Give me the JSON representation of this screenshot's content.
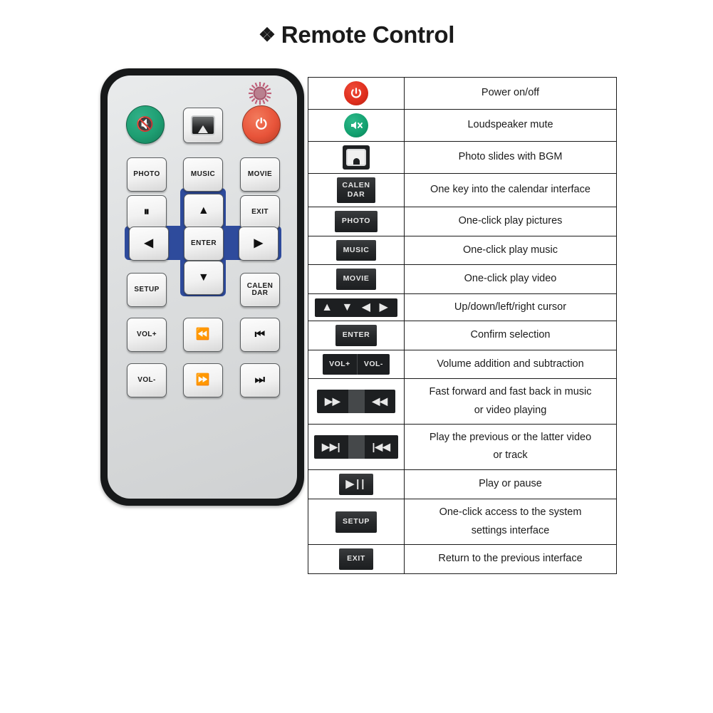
{
  "page": {
    "title": "Remote Control",
    "title_bullet": "diamond-bullet-icon"
  },
  "colors": {
    "remote_shell": "#17191a",
    "remote_face": "#dcdedf",
    "dpad_blue": "#2e4b9c",
    "power_red": "#e8543a",
    "mute_green": "#1e9e72",
    "table_border": "#1a1a1a",
    "keycap_dark": "#26282a"
  },
  "remote": {
    "name": "remote-control-device",
    "ir_led": "ir-led-icon",
    "buttons": [
      {
        "key": "mute",
        "label": "",
        "icon": "speaker-mute-icon",
        "shape": "round",
        "color": "green"
      },
      {
        "key": "photo-slide",
        "label": "",
        "icon": "photo-slideshow-icon",
        "shape": "square",
        "color": "white"
      },
      {
        "key": "power",
        "label": "",
        "icon": "power-icon",
        "shape": "round",
        "color": "red"
      },
      {
        "key": "photo",
        "label": "PHOTO",
        "icon": "",
        "shape": "square",
        "color": "white"
      },
      {
        "key": "music",
        "label": "MUSIC",
        "icon": "",
        "shape": "square",
        "color": "white"
      },
      {
        "key": "movie",
        "label": "MOVIE",
        "icon": "",
        "shape": "square",
        "color": "white"
      },
      {
        "key": "play-pause",
        "label": "",
        "icon": "play-pause-icon",
        "shape": "square",
        "color": "white"
      },
      {
        "key": "up",
        "label": "",
        "icon": "arrow-up-icon",
        "shape": "square",
        "color": "white"
      },
      {
        "key": "exit",
        "label": "EXIT",
        "icon": "",
        "shape": "square",
        "color": "white"
      },
      {
        "key": "left",
        "label": "",
        "icon": "arrow-left-icon",
        "shape": "square",
        "color": "white"
      },
      {
        "key": "enter",
        "label": "ENTER",
        "icon": "",
        "shape": "square",
        "color": "white"
      },
      {
        "key": "right",
        "label": "",
        "icon": "arrow-right-icon",
        "shape": "square",
        "color": "white"
      },
      {
        "key": "setup",
        "label": "SETUP",
        "icon": "",
        "shape": "square",
        "color": "white"
      },
      {
        "key": "down",
        "label": "",
        "icon": "arrow-down-icon",
        "shape": "square",
        "color": "white"
      },
      {
        "key": "calendar",
        "label": "CALEN DAR",
        "label_line1": "CALEN",
        "label_line2": "DAR",
        "icon": "",
        "shape": "square",
        "color": "white"
      },
      {
        "key": "vol-up",
        "label": "VOL+",
        "icon": "",
        "shape": "square",
        "color": "white"
      },
      {
        "key": "rewind",
        "label": "",
        "icon": "rewind-icon",
        "shape": "square",
        "color": "white"
      },
      {
        "key": "prev-track",
        "label": "",
        "icon": "previous-track-icon",
        "shape": "square",
        "color": "white"
      },
      {
        "key": "vol-down",
        "label": "VOL-",
        "icon": "",
        "shape": "square",
        "color": "white"
      },
      {
        "key": "fast-forward",
        "label": "",
        "icon": "fast-forward-icon",
        "shape": "square",
        "color": "white"
      },
      {
        "key": "next-track",
        "label": "",
        "icon": "next-track-icon",
        "shape": "square",
        "color": "white"
      }
    ]
  },
  "table": {
    "name": "remote-key-function-table",
    "rows": [
      {
        "icon_kind": "circle-red",
        "icon_name": "power-icon",
        "key_label": "",
        "description": "Power on/off"
      },
      {
        "icon_kind": "circle-green",
        "icon_name": "speaker-mute-icon",
        "key_label": "",
        "description": "Loudspeaker mute"
      },
      {
        "icon_kind": "monitor",
        "icon_name": "photo-slideshow-icon",
        "key_label": "",
        "description": "Photo slides with BGM"
      },
      {
        "icon_kind": "keycap2",
        "icon_name": "calendar-key",
        "key_label_line1": "CALEN",
        "key_label_line2": "DAR",
        "description": "One key into the calendar interface"
      },
      {
        "icon_kind": "keycap",
        "icon_name": "photo-key",
        "key_label": "PHOTO",
        "description": "One-click play pictures"
      },
      {
        "icon_kind": "keycap",
        "icon_name": "music-key",
        "key_label": "MUSIC",
        "description": "One-click play music"
      },
      {
        "icon_kind": "keycap",
        "icon_name": "movie-key",
        "key_label": "MOVIE",
        "description": "One-click play video"
      },
      {
        "icon_kind": "arrowbar",
        "icon_name": "cursor-arrows-icon",
        "key_label": "▲ ▼ ◀ ▶",
        "description": "Up/down/left/right cursor"
      },
      {
        "icon_kind": "keycap",
        "icon_name": "enter-key",
        "key_label": "ENTER",
        "description": "Confirm selection"
      },
      {
        "icon_kind": "split-text",
        "icon_name": "volume-keys",
        "key_label_a": "VOL+",
        "key_label_b": "VOL-",
        "description": "Volume addition and subtraction"
      },
      {
        "icon_kind": "split-glyph",
        "icon_name": "fast-forward-rewind-keys",
        "key_label_a": "▶▶",
        "key_label_b": "◀◀",
        "description": "Fast forward and fast back in music or video playing",
        "desc_line1": "Fast forward and fast back in music",
        "desc_line2": "or video playing"
      },
      {
        "icon_kind": "split-glyph",
        "icon_name": "next-prev-track-keys",
        "key_label_a": "▶▶|",
        "key_label_b": "|◀◀",
        "description": "Play the previous or the latter video or track",
        "desc_line1": "Play the previous or the latter video",
        "desc_line2": "or track"
      },
      {
        "icon_kind": "keycap-glyph",
        "icon_name": "play-pause-key",
        "key_label": "▶||",
        "description": "Play or pause"
      },
      {
        "icon_kind": "keycap",
        "icon_name": "setup-key",
        "key_label": "SETUP",
        "description": "One-click access to the system settings interface",
        "desc_line1": "One-click access to the system",
        "desc_line2": "settings interface"
      },
      {
        "icon_kind": "keycap",
        "icon_name": "exit-key",
        "key_label": "EXIT",
        "description": "Return to the previous interface"
      }
    ]
  }
}
